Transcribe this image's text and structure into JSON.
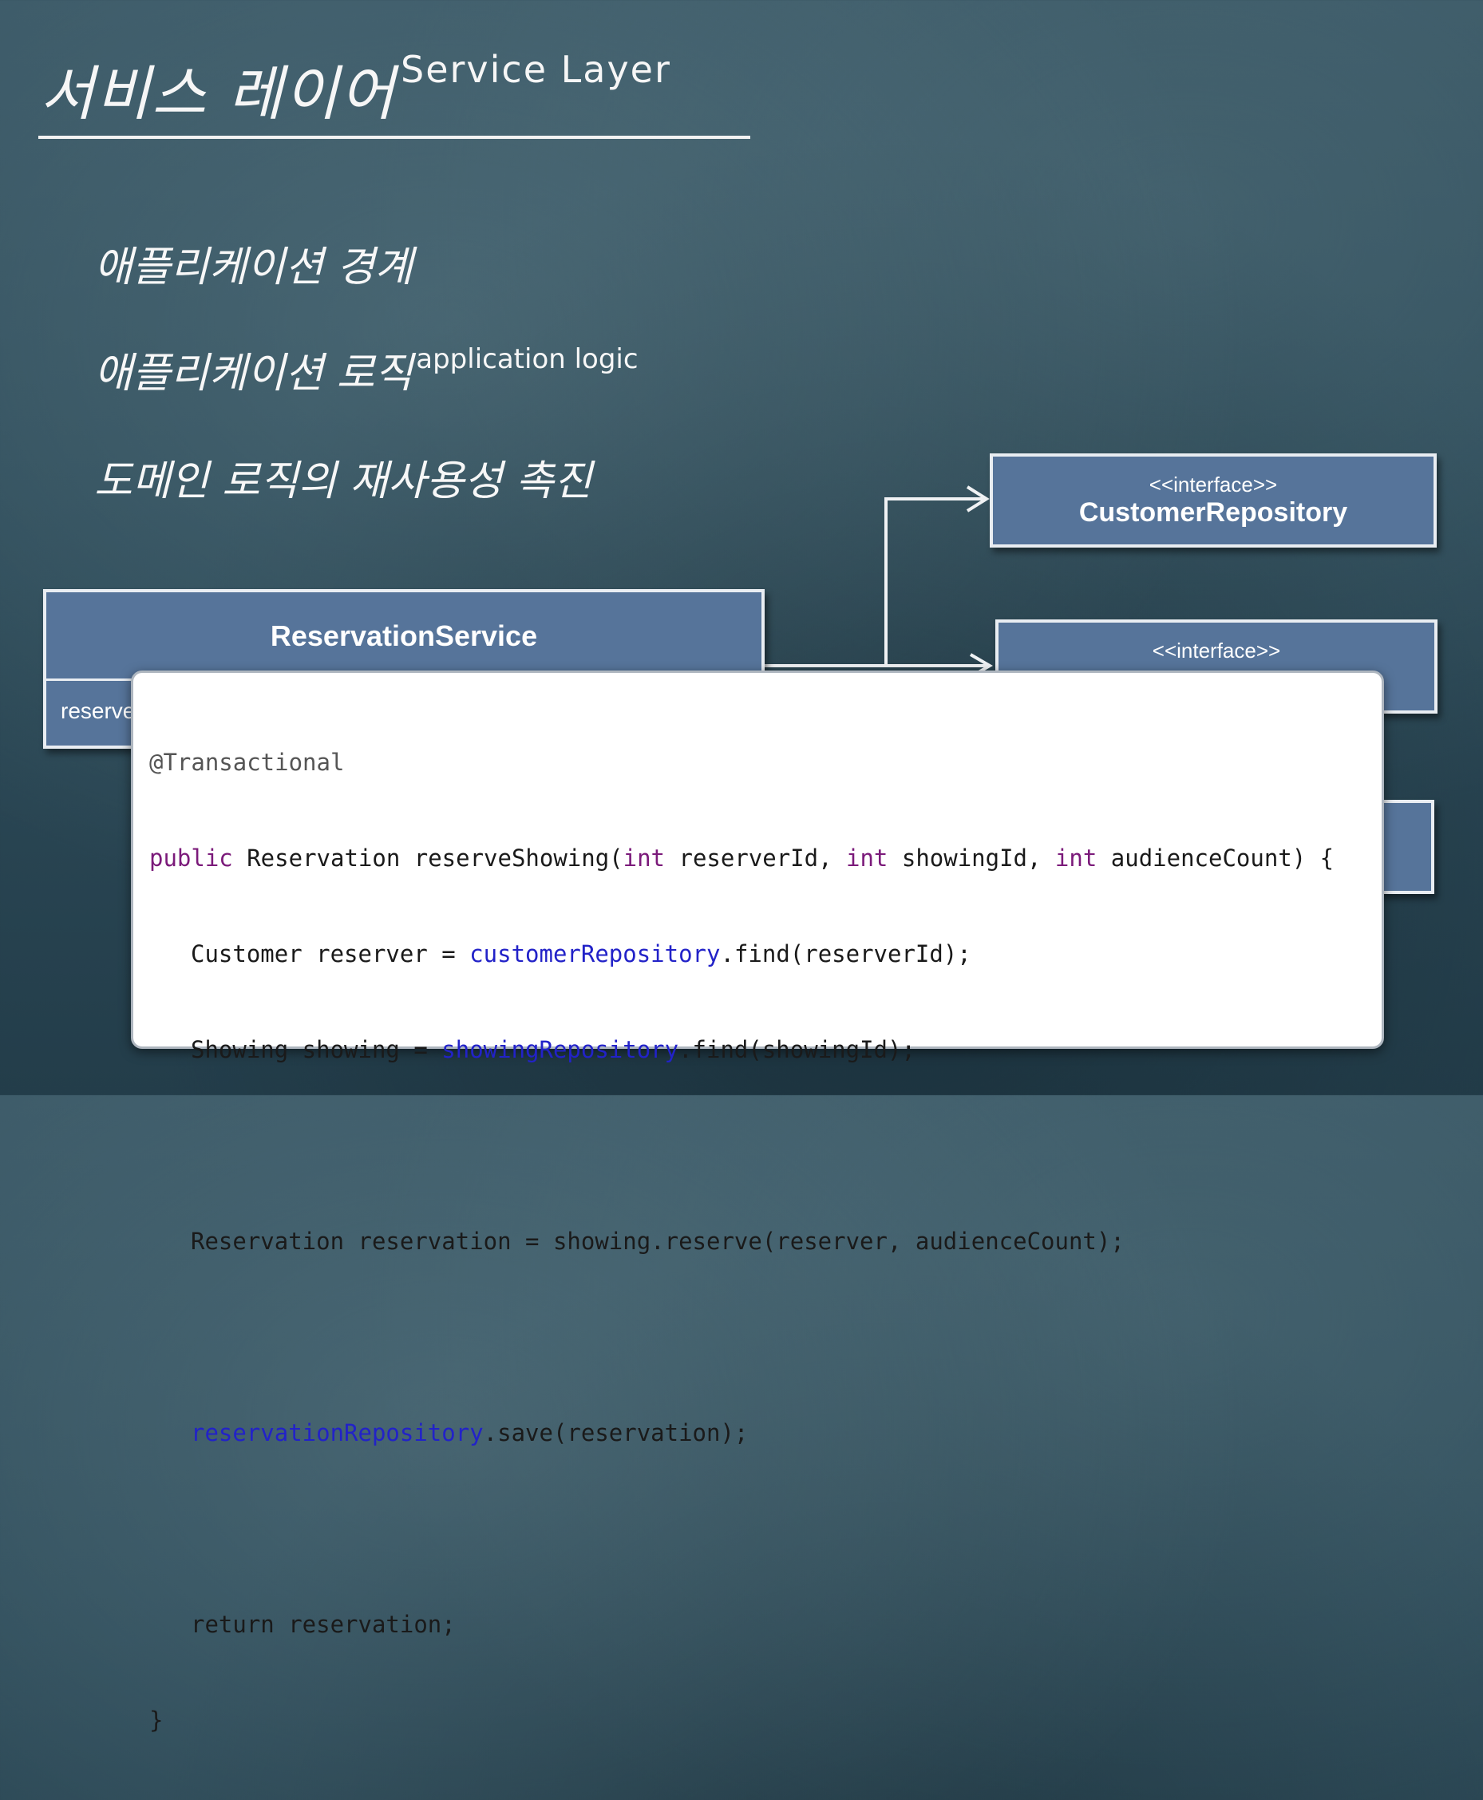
{
  "title": {
    "main": "서비스 레이어",
    "sub": "Service Layer"
  },
  "bullets": [
    {
      "text": "애플리케이션 경계",
      "sup": ""
    },
    {
      "text": "애플리케이션 로직",
      "sup": "application logic"
    },
    {
      "text": "도메인 로직의 재사용성 촉진",
      "sup": ""
    }
  ],
  "diagram": {
    "service": {
      "name": "ReservationService",
      "method_visible": "reserve"
    },
    "repositories": [
      {
        "stereotype": "<<interface>>",
        "name": "CustomerRepository"
      },
      {
        "stereotype": "<<interface>>",
        "name": ""
      },
      {
        "stereotype": "",
        "name": ""
      }
    ]
  },
  "code": {
    "annotation": "@Transactional",
    "signature": {
      "public": "public",
      "rest_before": " Reservation reserveShowing(",
      "int1": "int",
      "p1": " reserverId, ",
      "int2": "int",
      "p2": " showingId, ",
      "int3": "int",
      "p3": " audienceCount) {"
    },
    "line_customer": {
      "pre": "Customer reserver = ",
      "field": "customerRepository",
      "post": ".find(reserverId);"
    },
    "line_showing": {
      "pre": "Showing showing = ",
      "field": "showingRepository",
      "post": ".find(showingId);"
    },
    "line_reserve": "Reservation reservation = showing.reserve(reserver, audienceCount);",
    "line_save": {
      "field": "reservationRepository",
      "post": ".save(reservation);"
    },
    "line_return": "return reservation;",
    "closing": "}"
  },
  "colors": {
    "box_fill": "#56749a",
    "box_border": "#e9edf2",
    "keyword": "#7b1a7a",
    "field": "#2222c8"
  }
}
